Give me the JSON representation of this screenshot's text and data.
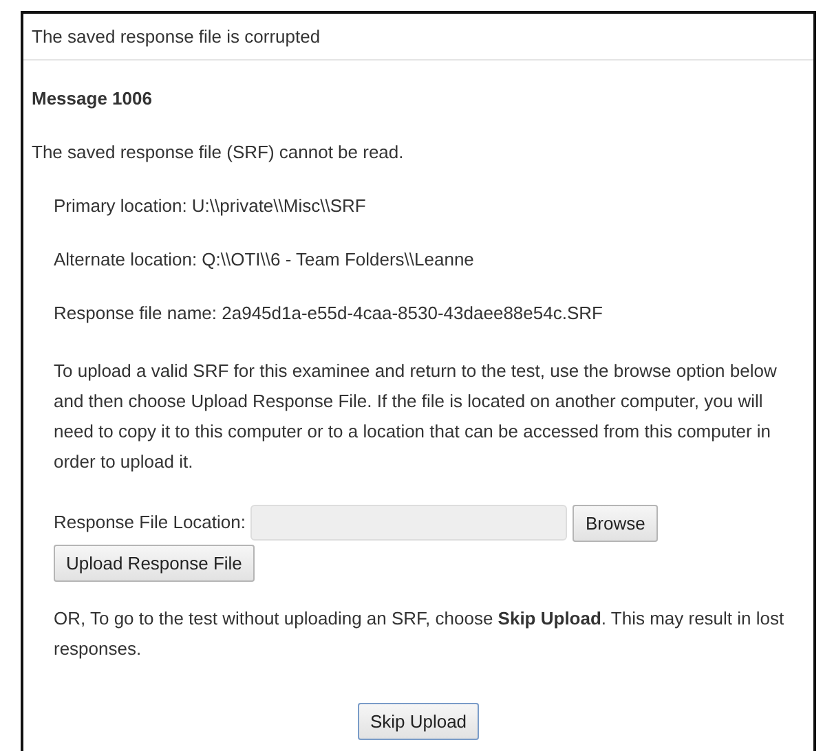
{
  "dialog": {
    "title": "The saved response file is corrupted"
  },
  "message": {
    "heading": "Message 1006",
    "summary": "The saved response file (SRF) cannot be read.",
    "details": [
      "Primary location: U:\\\\private\\\\Misc\\\\SRF",
      "Alternate location: Q:\\\\OTI\\\\6 - Team Folders\\\\Leanne",
      "Response file name: 2a945d1a-e55d-4caa-8530-43daee88e54c.SRF"
    ],
    "instructions": "To upload a valid SRF for this examinee and return to the test, use the browse option below and then choose Upload Response File. If the file is located on another computer, you will need to copy it to this computer or to a location that can be accessed from this computer in order to upload it."
  },
  "upload": {
    "label": "Response File Location:",
    "browse_button": "Browse",
    "upload_button": "Upload Response File"
  },
  "skip": {
    "note": "OR, To go to the test without uploading an SRF, choose **Skip Upload**. This may result in lost responses.",
    "button": "Skip Upload"
  }
}
